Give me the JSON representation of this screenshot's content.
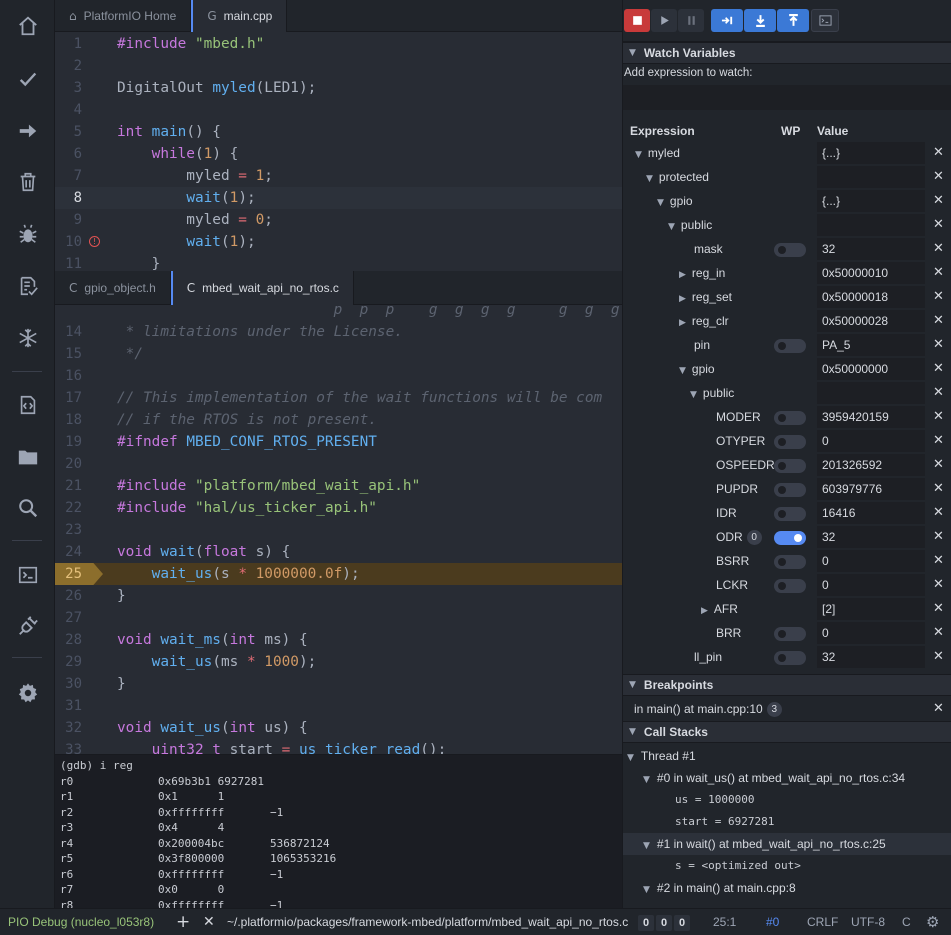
{
  "activity_bar": {
    "items": [
      {
        "name": "home-icon"
      },
      {
        "name": "build-icon"
      },
      {
        "name": "upload-icon"
      },
      {
        "name": "clean-icon"
      },
      {
        "name": "debug-icon"
      },
      {
        "name": "test-icon"
      },
      {
        "name": "serial-monitor-icon"
      },
      {
        "name": "code-icon"
      },
      {
        "name": "folder-icon"
      },
      {
        "name": "search-icon"
      },
      {
        "name": "terminal-icon"
      },
      {
        "name": "plug-icon"
      },
      {
        "name": "settings-icon"
      }
    ]
  },
  "top_editor": {
    "tabs": [
      {
        "label": "PlatformIO Home",
        "icon": "home-icon",
        "active": false
      },
      {
        "label": "main.cpp",
        "icon": "cpp-file-icon",
        "active": true
      }
    ],
    "lines": [
      {
        "n": "1",
        "parts": [
          [
            "pp",
            "#include "
          ],
          [
            "str",
            "\"mbed.h\""
          ]
        ]
      },
      {
        "n": "2",
        "parts": []
      },
      {
        "n": "3",
        "parts": [
          [
            "",
            "DigitalOut "
          ],
          [
            "fn",
            "myled"
          ],
          [
            "",
            "(LED1);"
          ]
        ]
      },
      {
        "n": "4",
        "parts": []
      },
      {
        "n": "5",
        "parts": [
          [
            "kw",
            "int "
          ],
          [
            "fn",
            "main"
          ],
          [
            "",
            "() {"
          ]
        ]
      },
      {
        "n": "6",
        "parts": [
          [
            "",
            "    "
          ],
          [
            "kw",
            "while"
          ],
          [
            "",
            "("
          ],
          [
            "num",
            "1"
          ],
          [
            "",
            ") {"
          ]
        ]
      },
      {
        "n": "7",
        "parts": [
          [
            "",
            "        myled "
          ],
          [
            "op",
            "="
          ],
          [
            "",
            ""
          ],
          [
            "num",
            " 1"
          ],
          [
            "",
            ";"
          ]
        ]
      },
      {
        "n": "8",
        "parts": [
          [
            "",
            "        "
          ],
          [
            "fn",
            "wait"
          ],
          [
            "",
            "("
          ],
          [
            "num",
            "1"
          ],
          [
            "",
            ");"
          ]
        ],
        "current": true
      },
      {
        "n": "9",
        "parts": [
          [
            "",
            "        myled "
          ],
          [
            "op",
            "="
          ],
          [
            "num",
            " 0"
          ],
          [
            "",
            ";"
          ]
        ]
      },
      {
        "n": "10",
        "parts": [
          [
            "",
            "        "
          ],
          [
            "fn",
            "wait"
          ],
          [
            "",
            "("
          ],
          [
            "num",
            "1"
          ],
          [
            "",
            ");"
          ]
        ],
        "breakpoint": true
      },
      {
        "n": "11",
        "parts": [
          [
            "",
            "    }"
          ]
        ]
      }
    ]
  },
  "bottom_editor": {
    "tabs": [
      {
        "label": "gpio_object.h",
        "icon": "c-file-icon",
        "active": false
      },
      {
        "label": "mbed_wait_api_no_rtos.c",
        "icon": "c-file-icon",
        "active": true
      }
    ],
    "lines": [
      {
        "n": "",
        "parts": [
          [
            "cm",
            "                         p  p  p    g  g  g  g     g  g  g  g"
          ]
        ]
      },
      {
        "n": "14",
        "parts": [
          [
            "cm",
            " * limitations under the License."
          ]
        ]
      },
      {
        "n": "15",
        "parts": [
          [
            "cm",
            " */"
          ]
        ]
      },
      {
        "n": "16",
        "parts": []
      },
      {
        "n": "17",
        "parts": [
          [
            "cm",
            "// This implementation of the wait functions will be com"
          ]
        ]
      },
      {
        "n": "18",
        "parts": [
          [
            "cm",
            "// if the RTOS is not present."
          ]
        ]
      },
      {
        "n": "19",
        "parts": [
          [
            "pp",
            "#ifndef "
          ],
          [
            "mac",
            "MBED_CONF_RTOS_PRESENT"
          ]
        ]
      },
      {
        "n": "20",
        "parts": []
      },
      {
        "n": "21",
        "parts": [
          [
            "pp",
            "#include "
          ],
          [
            "str",
            "\"platform/mbed_wait_api.h\""
          ]
        ]
      },
      {
        "n": "22",
        "parts": [
          [
            "pp",
            "#include "
          ],
          [
            "str",
            "\"hal/us_ticker_api.h\""
          ]
        ]
      },
      {
        "n": "23",
        "parts": []
      },
      {
        "n": "24",
        "parts": [
          [
            "ty",
            "void "
          ],
          [
            "fn",
            "wait"
          ],
          [
            "",
            "("
          ],
          [
            "ty",
            "float"
          ],
          [
            "",
            " s) {"
          ]
        ]
      },
      {
        "n": "25",
        "parts": [
          [
            "",
            "    "
          ],
          [
            "fn",
            "wait_us"
          ],
          [
            "",
            "(s "
          ],
          [
            "op",
            "*"
          ],
          [
            "num",
            " 1000000.0f"
          ],
          [
            "",
            ");"
          ]
        ],
        "exec": true
      },
      {
        "n": "26",
        "parts": [
          [
            "",
            "}"
          ]
        ]
      },
      {
        "n": "27",
        "parts": []
      },
      {
        "n": "28",
        "parts": [
          [
            "ty",
            "void "
          ],
          [
            "fn",
            "wait_ms"
          ],
          [
            "",
            "("
          ],
          [
            "ty",
            "int"
          ],
          [
            "",
            " ms) {"
          ]
        ]
      },
      {
        "n": "29",
        "parts": [
          [
            "",
            "    "
          ],
          [
            "fn",
            "wait_us"
          ],
          [
            "",
            "(ms "
          ],
          [
            "op",
            "*"
          ],
          [
            "num",
            " 1000"
          ],
          [
            "",
            ");"
          ]
        ]
      },
      {
        "n": "30",
        "parts": [
          [
            "",
            "}"
          ]
        ]
      },
      {
        "n": "31",
        "parts": []
      },
      {
        "n": "32",
        "parts": [
          [
            "ty",
            "void "
          ],
          [
            "fn",
            "wait_us"
          ],
          [
            "",
            "("
          ],
          [
            "ty",
            "int"
          ],
          [
            "",
            " us) {"
          ]
        ]
      },
      {
        "n": "33",
        "parts": [
          [
            "",
            "    "
          ],
          [
            "ty",
            "uint32_t"
          ],
          [
            "",
            " start "
          ],
          [
            "op",
            "="
          ],
          [
            "",
            ""
          ],
          [
            "fn",
            " us_ticker_read"
          ],
          [
            "",
            "();"
          ]
        ]
      }
    ]
  },
  "console": {
    "prompt": "(gdb) i reg",
    "rows": [
      [
        "r0",
        "0x69b3b1 6927281",
        ""
      ],
      [
        "r1",
        "0x1      1",
        ""
      ],
      [
        "r2",
        "0xffffffff",
        "−1"
      ],
      [
        "r3",
        "0x4      4",
        ""
      ],
      [
        "r4",
        "0x200004bc",
        "536872124"
      ],
      [
        "r5",
        "0x3f800000",
        "1065353216"
      ],
      [
        "r6",
        "0xffffffff",
        "−1"
      ],
      [
        "r7",
        "0x0      0",
        ""
      ],
      [
        "r8",
        "0xffffffff",
        "−1"
      ]
    ]
  },
  "debug_toolbar": {
    "buttons": [
      {
        "name": "stop-button",
        "icon": "stop-icon"
      },
      {
        "name": "continue-button",
        "icon": "play-icon"
      },
      {
        "name": "pause-button",
        "icon": "pause-icon"
      },
      {
        "name": "step-over-button",
        "icon": "step-over-icon"
      },
      {
        "name": "step-into-button",
        "icon": "step-into-icon"
      },
      {
        "name": "step-out-button",
        "icon": "step-out-icon"
      },
      {
        "name": "console-button",
        "icon": "terminal-icon"
      }
    ]
  },
  "watch": {
    "title": "Watch Variables",
    "add_label": "Add expression to watch:",
    "input_value": "",
    "headers": {
      "expression": "Expression",
      "wp": "WP",
      "value": "Value"
    },
    "rows": [
      {
        "label": "myled",
        "depth": 0,
        "arrow": "down",
        "value": "{...}",
        "toggle": null
      },
      {
        "label": "protected",
        "depth": 1,
        "arrow": "down",
        "value": "",
        "toggle": null
      },
      {
        "label": "gpio",
        "depth": 2,
        "arrow": "down",
        "value": "{...}",
        "toggle": null
      },
      {
        "label": "public",
        "depth": 3,
        "arrow": "down",
        "value": "",
        "toggle": null
      },
      {
        "label": "mask",
        "depth": 4,
        "arrow": "",
        "value": "32",
        "toggle": "off"
      },
      {
        "label": "reg_in",
        "depth": 4,
        "arrow": "right",
        "value": "0x50000010",
        "toggle": null
      },
      {
        "label": "reg_set",
        "depth": 4,
        "arrow": "right",
        "value": "0x50000018",
        "toggle": null
      },
      {
        "label": "reg_clr",
        "depth": 4,
        "arrow": "right",
        "value": "0x50000028",
        "toggle": null
      },
      {
        "label": "pin",
        "depth": 4,
        "arrow": "",
        "value": "PA_5",
        "toggle": "off"
      },
      {
        "label": "gpio",
        "depth": 4,
        "arrow": "down",
        "value": "0x50000000",
        "toggle": null
      },
      {
        "label": "public",
        "depth": 5,
        "arrow": "down",
        "value": "",
        "toggle": null
      },
      {
        "label": "MODER",
        "depth": 6,
        "arrow": "",
        "value": "3959420159",
        "toggle": "off"
      },
      {
        "label": "OTYPER",
        "depth": 6,
        "arrow": "",
        "value": "0",
        "toggle": "off"
      },
      {
        "label": "OSPEEDR",
        "depth": 6,
        "arrow": "",
        "value": "201326592",
        "toggle": "off"
      },
      {
        "label": "PUPDR",
        "depth": 6,
        "arrow": "",
        "value": "603979776",
        "toggle": "off"
      },
      {
        "label": "IDR",
        "depth": 6,
        "arrow": "",
        "value": "16416",
        "toggle": "off"
      },
      {
        "label": "ODR",
        "depth": 6,
        "arrow": "",
        "value": "32",
        "toggle": "on",
        "badge": "0"
      },
      {
        "label": "BSRR",
        "depth": 6,
        "arrow": "",
        "value": "0",
        "toggle": "off"
      },
      {
        "label": "LCKR",
        "depth": 6,
        "arrow": "",
        "value": "0",
        "toggle": "off"
      },
      {
        "label": "AFR",
        "depth": 6,
        "arrow": "right",
        "value": "[2]",
        "toggle": null
      },
      {
        "label": "BRR",
        "depth": 6,
        "arrow": "",
        "value": "0",
        "toggle": "off"
      },
      {
        "label": "ll_pin",
        "depth": 4,
        "arrow": "",
        "value": "32",
        "toggle": "off"
      }
    ]
  },
  "breakpoints": {
    "title": "Breakpoints",
    "item": "in main() at main.cpp:10",
    "count": "3"
  },
  "call_stacks": {
    "title": "Call Stacks",
    "thread": "Thread #1",
    "frames": [
      {
        "label": "#0 in wait_us() at mbed_wait_api_no_rtos.c:34",
        "selected": false,
        "vars": [
          "us = 1000000",
          "start = 6927281"
        ]
      },
      {
        "label": "#1 in wait() at mbed_wait_api_no_rtos.c:25",
        "selected": true,
        "vars": [
          "s = <optimized out>"
        ]
      },
      {
        "label": "#2 in main() at main.cpp:8",
        "selected": false,
        "vars": []
      }
    ]
  },
  "status_bar": {
    "env": "PIO Debug (nucleo_l053r8)",
    "path": "~/.platformio/packages/framework-mbed/platform/mbed_wait_api_no_rtos.c",
    "counters": [
      "0",
      "0",
      "0"
    ],
    "cursor": "25:1",
    "frame": "#0",
    "eol": "CRLF",
    "encoding": "UTF-8",
    "grammar": "C"
  },
  "colors": {
    "accent": "#568af2",
    "status_env": "#98c379",
    "stop": "#e05252",
    "exec_line": "#4b3b1e"
  }
}
